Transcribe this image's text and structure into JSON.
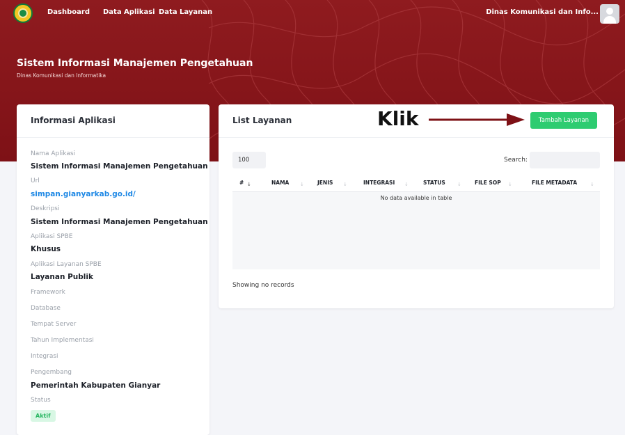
{
  "nav": {
    "items": [
      "Dashboard",
      "Data Aplikasi",
      "Data Layanan"
    ],
    "user_name": "Dinas Komunikasi dan Info..."
  },
  "header": {
    "title": "Sistem Informasi Manajemen Pengetahuan",
    "subtitle": "Dinas Komunikasi dan Informatika"
  },
  "info_card": {
    "title": "Informasi Aplikasi",
    "fields": [
      {
        "label": "Nama Aplikasi",
        "value": "Sistem Informasi Manajemen Pengetahuan"
      },
      {
        "label": "Url",
        "value": "simpan.gianyarkab.go.id/"
      },
      {
        "label": "Deskripsi",
        "value": "Sistem Informasi Manajemen Pengetahuan"
      },
      {
        "label": "Aplikasi SPBE",
        "value": "Khusus"
      },
      {
        "label": "Aplikasi Layanan SPBE",
        "value": "Layanan Publik"
      },
      {
        "label": "Framework",
        "value": ""
      },
      {
        "label": "Database",
        "value": ""
      },
      {
        "label": "Tempat Server",
        "value": ""
      },
      {
        "label": "Tahun Implementasi",
        "value": ""
      },
      {
        "label": "Integrasi",
        "value": ""
      },
      {
        "label": "Pengembang",
        "value": "Pemerintah Kabupaten Gianyar"
      },
      {
        "label": "Status",
        "value": ""
      }
    ],
    "status_badge": "Aktif"
  },
  "list_card": {
    "title": "List Layanan",
    "annotation": "Klik",
    "add_button": "Tambah Layanan",
    "page_length": "100",
    "search_label": "Search:",
    "columns": [
      "#",
      "NAMA",
      "JENIS",
      "INTEGRASI",
      "STATUS",
      "FILE SOP",
      "FILE METADATA"
    ],
    "empty_message": "No data available in table",
    "info": "Showing no records"
  },
  "colors": {
    "brand": "#8f1b1f",
    "success": "#2ecc71",
    "link": "#1e88e5"
  }
}
